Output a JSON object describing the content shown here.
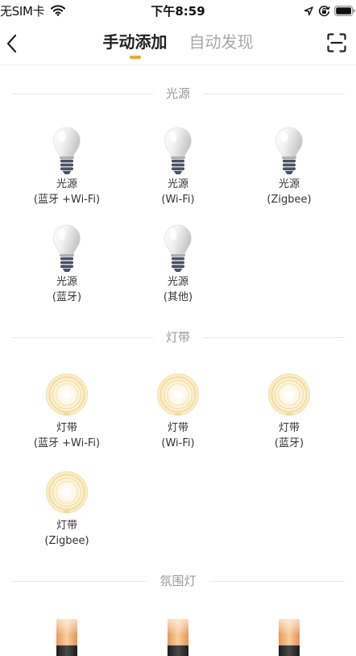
{
  "status_bar": {
    "carrier": "无SIM卡",
    "time": "下午8:59",
    "icons": [
      "wifi-icon",
      "location-arrow-icon",
      "orientation-lock-icon",
      "battery-icon"
    ]
  },
  "nav": {
    "back_icon": "chevron-left-icon",
    "tabs": [
      {
        "label": "手动添加",
        "active": true
      },
      {
        "label": "自动发现",
        "active": false
      }
    ],
    "scan_icon": "scan-icon"
  },
  "colors": {
    "accent": "#f5a623",
    "active_tab": "#222222",
    "inactive_tab": "#a8a8a8",
    "section_title": "#999999",
    "label": "#333333",
    "divider": "#e6e6e6"
  },
  "sections": [
    {
      "title": "光源",
      "icon": "bulb-icon",
      "items": [
        {
          "name": "光源",
          "protocol": "(蓝牙 +Wi-Fi)"
        },
        {
          "name": "光源",
          "protocol": "(Wi-Fi)"
        },
        {
          "name": "光源",
          "protocol": "(Zigbee)"
        },
        {
          "name": "光源",
          "protocol": "(蓝牙)"
        },
        {
          "name": "光源",
          "protocol": "(其他)"
        }
      ]
    },
    {
      "title": "灯带",
      "icon": "light-strip-icon",
      "items": [
        {
          "name": "灯带",
          "protocol": "(蓝牙 +Wi-Fi)"
        },
        {
          "name": "灯带",
          "protocol": "(Wi-Fi)"
        },
        {
          "name": "灯带",
          "protocol": "(蓝牙)"
        },
        {
          "name": "灯带",
          "protocol": "(Zigbee)"
        }
      ]
    },
    {
      "title": "氛围灯",
      "icon": "ambient-lamp-icon",
      "items": [
        {
          "icon": "ambient-lamp-icon"
        },
        {
          "icon": "ambient-lamp-icon"
        },
        {
          "icon": "ambient-lamp-icon"
        }
      ]
    }
  ]
}
